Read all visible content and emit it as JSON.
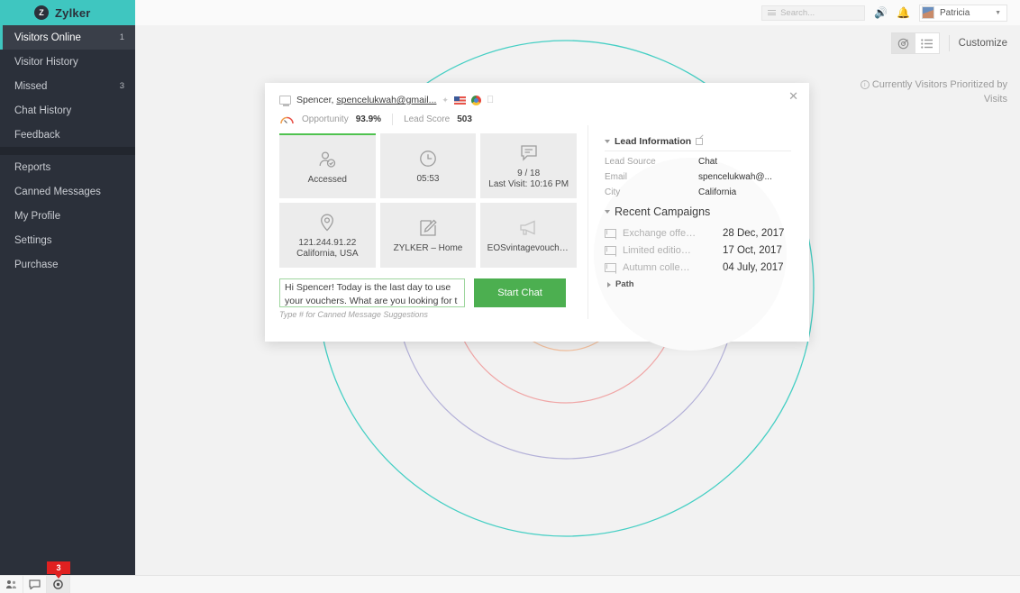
{
  "brand": {
    "badge": "Z",
    "name": "Zylker"
  },
  "sidebar": {
    "items": [
      {
        "label": "Visitors Online",
        "badge": "1",
        "active": true
      },
      {
        "label": "Visitor History",
        "badge": "",
        "active": false
      },
      {
        "label": "Missed",
        "badge": "3",
        "active": false
      },
      {
        "label": "Chat History",
        "badge": "",
        "active": false
      },
      {
        "label": "Feedback",
        "badge": "",
        "active": false
      },
      {
        "label": "Reports",
        "badge": "",
        "active": false
      },
      {
        "label": "Canned Messages",
        "badge": "",
        "active": false
      },
      {
        "label": "My Profile",
        "badge": "",
        "active": false
      },
      {
        "label": "Settings",
        "badge": "",
        "active": false
      },
      {
        "label": "Purchase",
        "badge": "",
        "active": false
      }
    ]
  },
  "topbar": {
    "search_placeholder": "Search...",
    "sound_icon": "speaker-icon",
    "notification_icon": "bell-icon",
    "user_name": "Patricia",
    "caret_icon": "chevron-down-icon"
  },
  "toolbar": {
    "view_radar_icon": "radar-view-icon",
    "view_list_icon": "list-view-icon",
    "customize_label": "Customize"
  },
  "priority_note": {
    "info_icon": "info-icon",
    "text": "Currently Visitors Prioritized by Visits"
  },
  "statusbar": {
    "buttons": [
      {
        "icon": "visitors-icon",
        "selected": false
      },
      {
        "icon": "chat-icon",
        "selected": false
      },
      {
        "icon": "settings-icon",
        "selected": true
      }
    ],
    "badge_count": "3"
  },
  "modal": {
    "close_icon": "close-icon",
    "monitor_icon": "monitor-icon",
    "visitor_name": "Spencer, ",
    "visitor_email": "spencelukwah@gmail...",
    "star_icon": "star-icon",
    "flag_icon": "us-flag-icon",
    "browser_icon": "chrome-icon",
    "os_icon": "apple-icon",
    "gauge_icon": "gauge-icon",
    "opportunity_label": "Opportunity",
    "opportunity_value": "93.9%",
    "lead_score_label": "Lead Score",
    "lead_score_value": "503",
    "cards": [
      {
        "icon": "user-check-icon",
        "line1": "Accessed",
        "line2": "",
        "accent": true
      },
      {
        "icon": "clock-icon",
        "line1": "05:53",
        "line2": "",
        "accent": false
      },
      {
        "icon": "chat-bubble-icon",
        "line1": "9 / 18",
        "line2": "Last Visit: 10:16 PM",
        "accent": false
      },
      {
        "icon": "location-pin-icon",
        "line1": "121.244.91.22",
        "line2": "California, USA",
        "accent": false
      },
      {
        "icon": "pencil-square-icon",
        "line1": "ZYLKER – Home",
        "line2": "",
        "accent": false
      },
      {
        "icon": "megaphone-icon",
        "line1": "EOSvintagevouchers…",
        "line2": "",
        "accent": false
      }
    ],
    "composer": {
      "message": "Hi Spencer! Today is the last day to use your vouchers. What are you looking for t",
      "start_chat_label": "Start Chat",
      "hint": "Type # for Canned Message Suggestions"
    },
    "lead_information": {
      "title": "Lead Information",
      "external_icon": "external-link-icon",
      "fields": [
        {
          "key": "Lead Source",
          "value": "Chat"
        },
        {
          "key": "Email",
          "value": "spencelukwah@..."
        },
        {
          "key": "City",
          "value": "California"
        }
      ]
    },
    "recent_campaigns": {
      "title": "Recent Campaigns",
      "items": [
        {
          "icon": "mail-icon",
          "name": "Exchange offe…",
          "date": "28 Dec, 2017"
        },
        {
          "icon": "mail-icon",
          "name": "Limited editio…",
          "date": "17 Oct, 2017"
        },
        {
          "icon": "mail-icon",
          "name": "Autumn colle…",
          "date": "04 July, 2017"
        }
      ]
    },
    "path": {
      "title": "Path"
    }
  },
  "colors": {
    "brand_teal": "#3fc6c0",
    "sidebar_dark": "#2b303a",
    "accent_green": "#4caf50",
    "badge_red": "#e02020",
    "ring_teal": "#45cfc4",
    "ring_purple": "#b3b0d8",
    "ring_pink": "#f0a6a6",
    "ring_orange": "#f5c2a0"
  }
}
